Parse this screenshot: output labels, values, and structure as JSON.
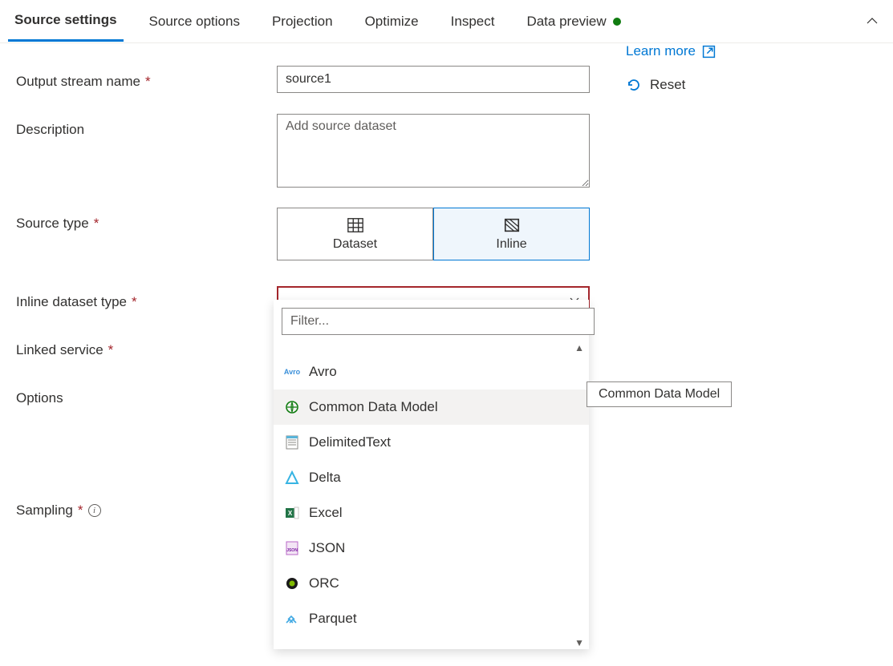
{
  "tabs": [
    {
      "label": "Source settings",
      "active": true
    },
    {
      "label": "Source options",
      "active": false
    },
    {
      "label": "Projection",
      "active": false
    },
    {
      "label": "Optimize",
      "active": false
    },
    {
      "label": "Inspect",
      "active": false
    },
    {
      "label": "Data preview",
      "active": false,
      "status": "green"
    }
  ],
  "side": {
    "learn_more": "Learn more",
    "reset": "Reset"
  },
  "form": {
    "output_stream_label": "Output stream name",
    "output_stream_value": "source1",
    "description_label": "Description",
    "description_placeholder": "Add source dataset",
    "description_value": "",
    "source_type_label": "Source type",
    "source_type_options": [
      {
        "label": "Dataset",
        "selected": false
      },
      {
        "label": "Inline",
        "selected": true
      }
    ],
    "inline_dataset_type_label": "Inline dataset type",
    "inline_dataset_type_value": "",
    "linked_service_label": "Linked service",
    "options_label": "Options",
    "sampling_label": "Sampling"
  },
  "dropdown": {
    "filter_placeholder": "Filter...",
    "items": [
      {
        "label": "Avro",
        "icon": "avro"
      },
      {
        "label": "Common Data Model",
        "icon": "cdm",
        "hovered": true
      },
      {
        "label": "DelimitedText",
        "icon": "delimited"
      },
      {
        "label": "Delta",
        "icon": "delta"
      },
      {
        "label": "Excel",
        "icon": "excel"
      },
      {
        "label": "JSON",
        "icon": "json"
      },
      {
        "label": "ORC",
        "icon": "orc"
      },
      {
        "label": "Parquet",
        "icon": "parquet"
      }
    ]
  },
  "tooltip": "Common Data Model"
}
